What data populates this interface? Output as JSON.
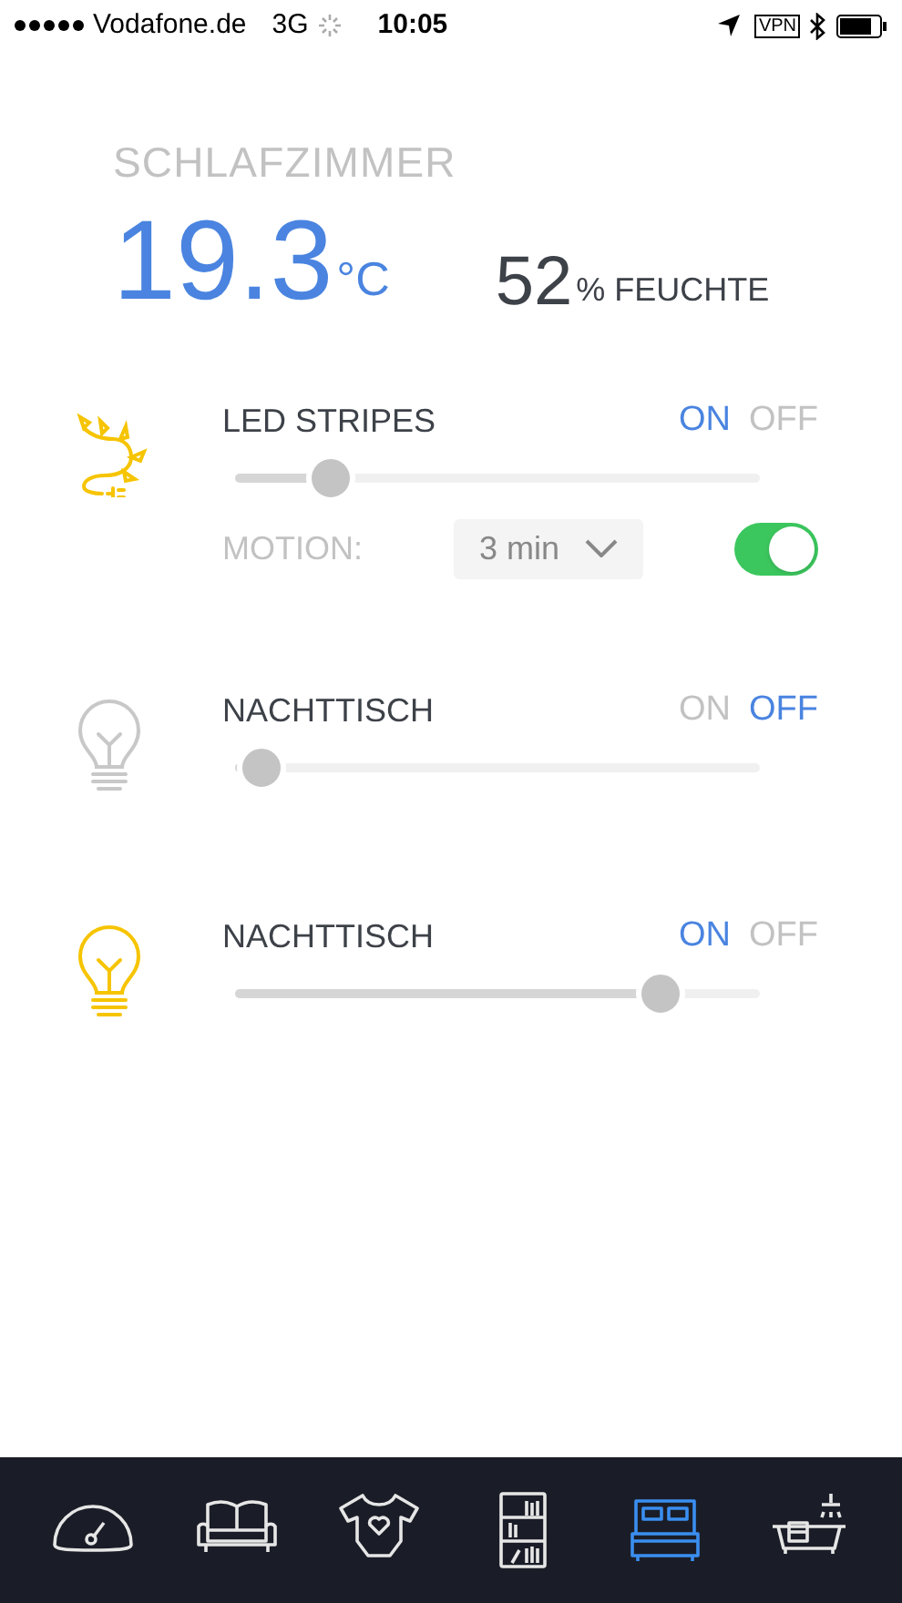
{
  "status_bar": {
    "carrier": "Vodafone.de",
    "network": "3G",
    "time": "10:05",
    "vpn": "VPN"
  },
  "room": {
    "name": "SCHLAFZIMMER",
    "temperature": "19.3",
    "temperature_unit": "°C",
    "humidity": "52",
    "humidity_unit": "% FEUCHTE"
  },
  "devices": [
    {
      "kind": "led_strip",
      "name": "LED STRIPES",
      "on_label": "ON",
      "off_label": "OFF",
      "on": true,
      "level": 0.18,
      "motion": {
        "label": "MOTION:",
        "value": "3 min",
        "enabled": true
      }
    },
    {
      "kind": "bulb",
      "name": "NACHTTISCH",
      "on_label": "ON",
      "off_label": "OFF",
      "on": false,
      "level": 0.05
    },
    {
      "kind": "bulb",
      "name": "NACHTTISCH",
      "on_label": "ON",
      "off_label": "OFF",
      "on": true,
      "level": 0.81
    }
  ],
  "tabs": [
    {
      "kind": "gauge",
      "selected": false
    },
    {
      "kind": "sofa",
      "selected": false
    },
    {
      "kind": "bodysuit",
      "selected": false
    },
    {
      "kind": "shelf",
      "selected": false
    },
    {
      "kind": "bed",
      "selected": true
    },
    {
      "kind": "bathtub",
      "selected": false
    }
  ]
}
